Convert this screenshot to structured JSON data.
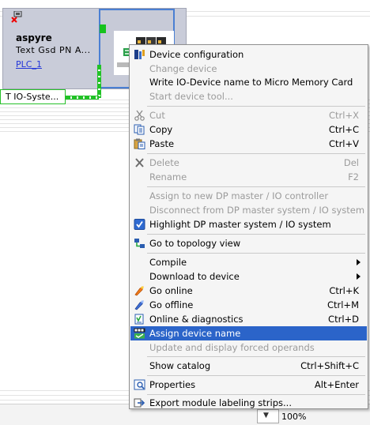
{
  "device": {
    "name": "aspyre",
    "type": "Text Gsd PN A...",
    "plc_link": "PLC_1",
    "io_system_label": "T IO-Syste..."
  },
  "zoom": {
    "value": "100%"
  },
  "menu": {
    "items": [
      {
        "label": "Device configuration",
        "shortcut": "",
        "enabled": true,
        "icon": "device-config-icon"
      },
      {
        "label": "Change device",
        "shortcut": "",
        "enabled": false,
        "icon": ""
      },
      {
        "label": "Write IO-Device name to Micro Memory Card",
        "shortcut": "",
        "enabled": true,
        "icon": ""
      },
      {
        "label": "Start device tool...",
        "shortcut": "",
        "enabled": false,
        "icon": ""
      },
      {
        "label": "Cut",
        "shortcut": "Ctrl+X",
        "enabled": false,
        "icon": "scissors-icon"
      },
      {
        "label": "Copy",
        "shortcut": "Ctrl+C",
        "enabled": true,
        "icon": "copy-icon"
      },
      {
        "label": "Paste",
        "shortcut": "Ctrl+V",
        "enabled": true,
        "icon": "paste-icon"
      },
      {
        "label": "Delete",
        "shortcut": "Del",
        "enabled": false,
        "icon": "delete-icon"
      },
      {
        "label": "Rename",
        "shortcut": "F2",
        "enabled": false,
        "icon": ""
      },
      {
        "label": "Assign to new DP master / IO controller",
        "shortcut": "",
        "enabled": false,
        "icon": ""
      },
      {
        "label": "Disconnect from DP master system / IO system",
        "shortcut": "",
        "enabled": false,
        "icon": ""
      },
      {
        "label": "Highlight DP master system / IO system",
        "shortcut": "",
        "enabled": true,
        "icon": "checkbox-checked-icon"
      },
      {
        "label": "Go to topology view",
        "shortcut": "",
        "enabled": true,
        "icon": "topology-icon"
      },
      {
        "label": "Compile",
        "shortcut": "",
        "enabled": true,
        "icon": "",
        "submenu": true
      },
      {
        "label": "Download to device",
        "shortcut": "",
        "enabled": true,
        "icon": "",
        "submenu": true
      },
      {
        "label": "Go online",
        "shortcut": "Ctrl+K",
        "enabled": true,
        "icon": "go-online-icon"
      },
      {
        "label": "Go offline",
        "shortcut": "Ctrl+M",
        "enabled": true,
        "icon": "go-offline-icon"
      },
      {
        "label": "Online & diagnostics",
        "shortcut": "Ctrl+D",
        "enabled": true,
        "icon": "diagnostics-icon"
      },
      {
        "label": "Assign device name",
        "shortcut": "",
        "enabled": true,
        "icon": "assign-name-icon",
        "highlighted": true
      },
      {
        "label": "Update and display forced operands",
        "shortcut": "",
        "enabled": false,
        "icon": ""
      },
      {
        "label": "Show catalog",
        "shortcut": "Ctrl+Shift+C",
        "enabled": true,
        "icon": ""
      },
      {
        "label": "Properties",
        "shortcut": "Alt+Enter",
        "enabled": true,
        "icon": "properties-icon"
      },
      {
        "label": "Export module labeling strips...",
        "shortcut": "",
        "enabled": true,
        "icon": "export-icon"
      }
    ]
  },
  "colors": {
    "highlight": "#2b64c9",
    "disabled_text": "#9b9b9b",
    "bus_green": "#21c226",
    "device_bg": "#c9ccd9"
  }
}
